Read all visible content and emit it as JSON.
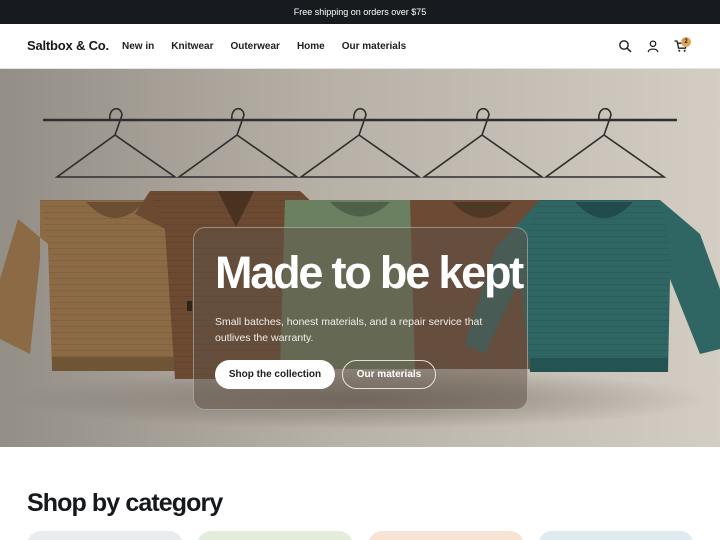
{
  "announcement": {
    "text": "Free shipping on orders over $75"
  },
  "header": {
    "logo": "Saltbox & Co.",
    "nav": [
      "New in",
      "Knitwear",
      "Outerwear",
      "Home",
      "Our materials"
    ],
    "icons": [
      "search-icon",
      "account-icon",
      "cart-icon"
    ],
    "cart_count": "2"
  },
  "hero": {
    "title": "Made to be kept",
    "subtitle": "Small batches, honest materials, and a repair service that outlives the warranty.",
    "primary_button": "Shop the collection",
    "secondary_button": "Our materials"
  },
  "categories": {
    "heading": "Shop by category",
    "tile_colors": [
      "#e9ebee",
      "#e4ecdc",
      "#f6e3d3",
      "#e1ebef"
    ]
  },
  "colors": {
    "announcement_bg": "#171b20",
    "cart_badge": "#e3a35a",
    "sweater_tan": "#8b6a45",
    "sweater_brown": "#6b4a31",
    "sweater_sage": "#6b7f61",
    "sweater_teal": "#2f6563"
  }
}
